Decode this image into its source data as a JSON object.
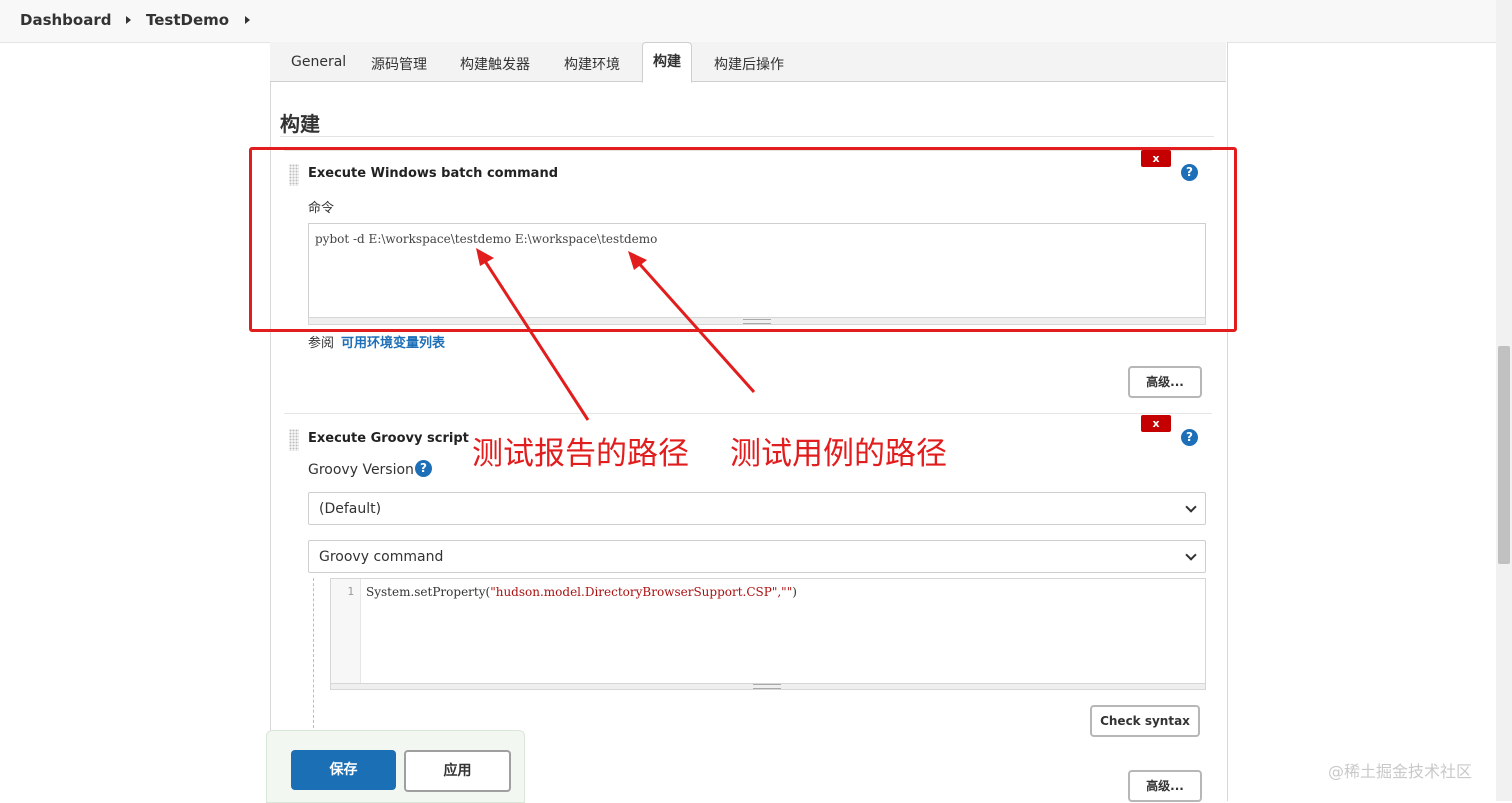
{
  "breadcrumb": {
    "items": [
      "Dashboard",
      "TestDemo"
    ]
  },
  "tabs": [
    {
      "label": "General",
      "active": false
    },
    {
      "label": "源码管理",
      "active": false
    },
    {
      "label": "构建触发器",
      "active": false
    },
    {
      "label": "构建环境",
      "active": false
    },
    {
      "label": "构建",
      "active": true
    },
    {
      "label": "构建后操作",
      "active": false
    }
  ],
  "section": {
    "title": "构建"
  },
  "step1": {
    "title": "Execute Windows batch command",
    "delete_label": "x",
    "help_label": "?",
    "command_label": "命令",
    "command_value": "pybot -d E:\\workspace\\testdemo E:\\workspace\\testdemo",
    "see_prefix": "参阅",
    "env_link": "可用环境变量列表",
    "advanced_label": "高级..."
  },
  "step2": {
    "title": "Execute Groovy script",
    "delete_label": "x",
    "help_label": "?",
    "groovy_version_label": "Groovy Version",
    "groovy_version_value": "(Default)",
    "groovy_mode_value": "Groovy command",
    "code_line_number": "1",
    "code_plain": "System.setProperty(",
    "code_string": "\"hudson.model.DirectoryBrowserSupport.CSP\",\"\"",
    "code_end": ")",
    "check_syntax_label": "Check syntax",
    "advanced_label": "高级..."
  },
  "actions": {
    "save_label": "保存",
    "apply_label": "应用"
  },
  "annotations": {
    "report_path": "测试报告的路径",
    "case_path": "测试用例的路径",
    "color": "#e21d1d"
  },
  "watermark": "@稀土掘金技术社区",
  "colors": {
    "accent": "#1a6fb5",
    "delete": "#c40000",
    "annotation": "#e21d1d"
  }
}
